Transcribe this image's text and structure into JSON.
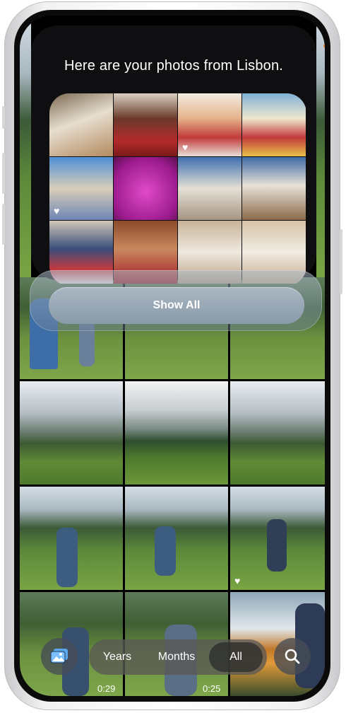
{
  "sheet": {
    "title": "Here are your photos from Lisbon.",
    "show_all_label": "Show All"
  },
  "toolbar": {
    "library_icon": "photo-library-icon",
    "segments": [
      "Years",
      "Months",
      "All"
    ],
    "selected": "All",
    "search_icon": "search-icon"
  },
  "grid": {
    "durations": [
      "0:29",
      "0:25"
    ]
  }
}
